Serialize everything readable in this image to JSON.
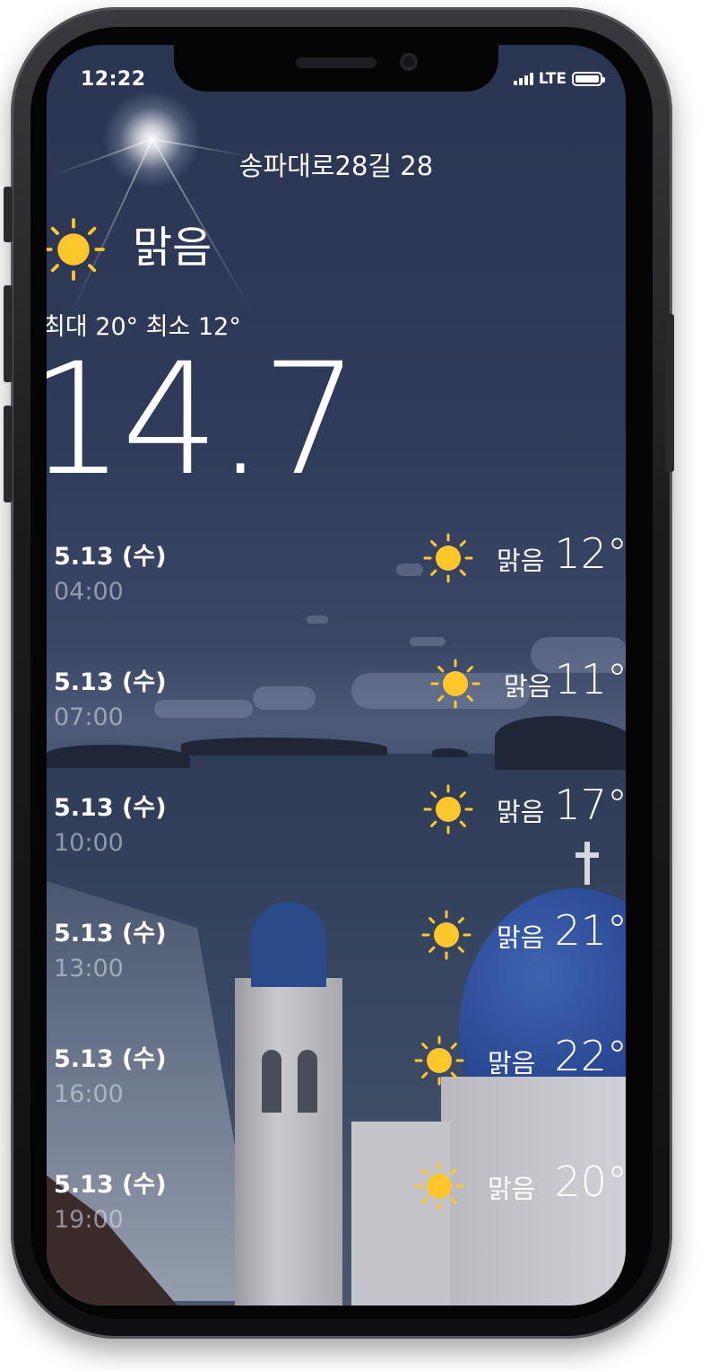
{
  "status_bar": {
    "time": "12:22",
    "network": "LTE"
  },
  "location": "송파대로28길 28",
  "current": {
    "condition": "맑음",
    "icon": "sun-icon",
    "min_max": "최대 20° 최소 12°",
    "temperature": "14.7"
  },
  "hourly": [
    {
      "date": "5.13 (수)",
      "time": "04:00",
      "condition": "맑음",
      "temp": "12°",
      "icon": "sun-icon"
    },
    {
      "date": "5.13 (수)",
      "time": "07:00",
      "condition": "맑음",
      "temp": "11°",
      "icon": "sun-icon"
    },
    {
      "date": "5.13 (수)",
      "time": "10:00",
      "condition": "맑음",
      "temp": "17°",
      "icon": "sun-icon"
    },
    {
      "date": "5.13 (수)",
      "time": "13:00",
      "condition": "맑음",
      "temp": "21°",
      "icon": "sun-icon"
    },
    {
      "date": "5.13 (수)",
      "time": "16:00",
      "condition": "맑음",
      "temp": "22°",
      "icon": "sun-icon"
    },
    {
      "date": "5.13 (수)",
      "time": "19:00",
      "condition": "맑음",
      "temp": "20°",
      "icon": "sun-icon"
    }
  ],
  "colors": {
    "sun": "#FFC72C",
    "text": "#FFFFFF",
    "time_text": "#DCE1EB"
  }
}
